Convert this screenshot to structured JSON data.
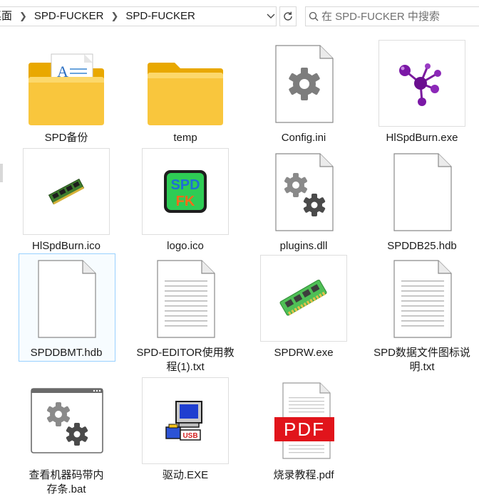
{
  "address": {
    "crumbs": [
      "桌面",
      "SPD-FUCKER",
      "SPD-FUCKER"
    ]
  },
  "search": {
    "placeholder": "在 SPD-FUCKER 中搜索"
  },
  "items": [
    {
      "name": "SPD备份",
      "icon": "folder-document-icon"
    },
    {
      "name": "temp",
      "icon": "folder-icon"
    },
    {
      "name": "Config.ini",
      "icon": "settings-file-icon"
    },
    {
      "name": "HlSpdBurn.exe",
      "icon": "molecule-icon"
    },
    {
      "name": "HlSpdBurn.ico",
      "icon": "memory-stick-icon"
    },
    {
      "name": "logo.ico",
      "icon": "spd-fk-logo-icon"
    },
    {
      "name": "plugins.dll",
      "icon": "dll-gears-icon"
    },
    {
      "name": "SPDDB25.hdb",
      "icon": "blank-file-icon"
    },
    {
      "name": "SPDDBMT.hdb",
      "icon": "blank-file-icon"
    },
    {
      "name": "SPD-EDITOR使用教程(1).txt",
      "icon": "text-file-icon"
    },
    {
      "name": "SPDRW.exe",
      "icon": "memory-module-icon"
    },
    {
      "name": "SPD数据文件图标说明.txt",
      "icon": "text-file-icon"
    },
    {
      "name": "查看机器码带内存条.bat",
      "icon": "batch-window-icon"
    },
    {
      "name": "驱动.EXE",
      "icon": "usb-computer-icon"
    },
    {
      "name": "烧录教程.pdf",
      "icon": "pdf-file-icon"
    }
  ],
  "pdf_badge": "PDF",
  "logo_text": {
    "top": "SPD",
    "bottom": "FK"
  }
}
